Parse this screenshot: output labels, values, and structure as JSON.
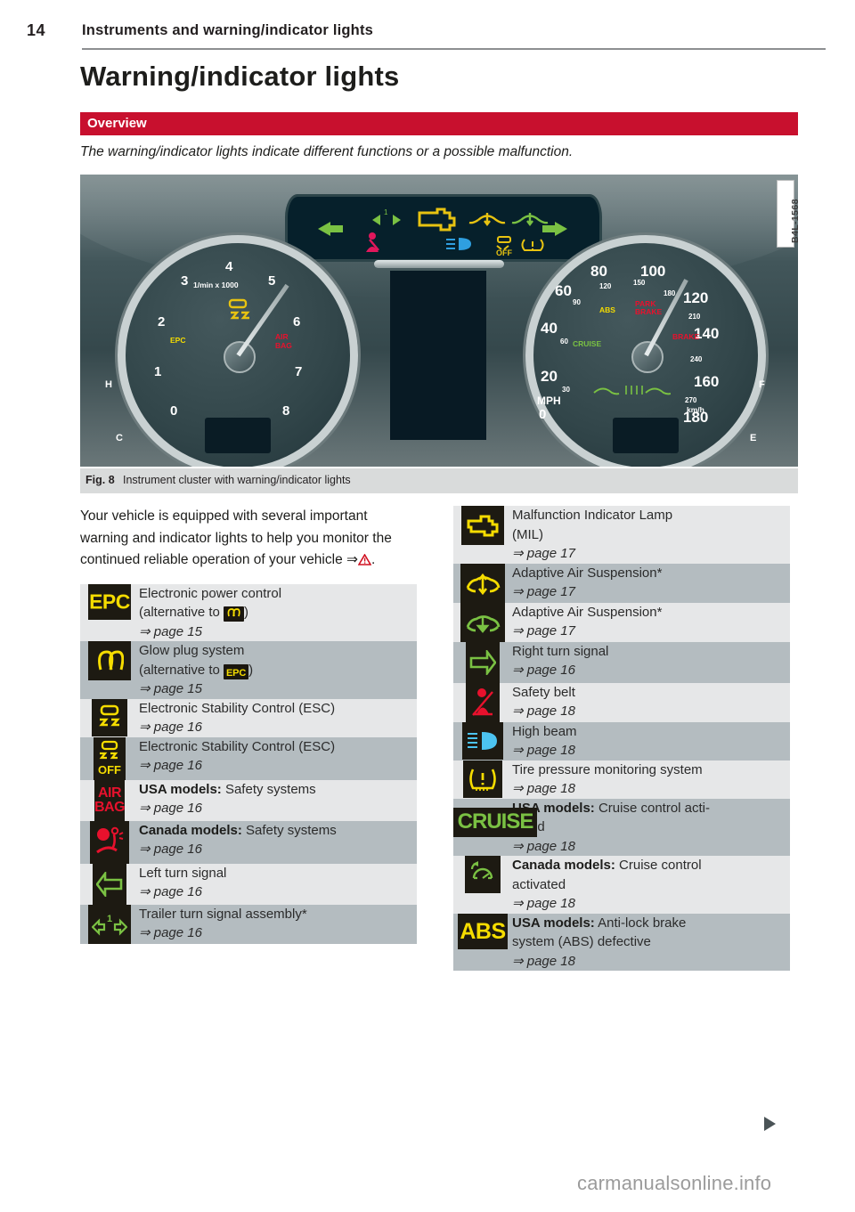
{
  "runhead": {
    "page_number": "14",
    "chapter": "Instruments and warning/indicator lights"
  },
  "heading": "Warning/indicator lights",
  "section_band": {
    "label": "Overview",
    "color": "#c8102e"
  },
  "intro_italic": "The warning/indicator lights indicate different functions or a possible malfunction.",
  "figure": {
    "id_label": "B4L-1568",
    "caption_label": "Fig. 8",
    "caption_text": "Instrument cluster with warning/indicator lights",
    "cluster": {
      "tach_unit": "1/min x 1000",
      "tach_numbers": [
        "1",
        "2",
        "3",
        "4",
        "5",
        "6",
        "7",
        "8",
        "0"
      ],
      "tach_warnings": [
        "EPC",
        "AIR BAG",
        "ESC"
      ],
      "speedo_mph": [
        "0",
        "20",
        "40",
        "60",
        "80",
        "100",
        "120",
        "140",
        "160",
        "180"
      ],
      "speedo_mph_small": [
        "30",
        "60",
        "90",
        "120",
        "150",
        "180"
      ],
      "speedo_kmh": [
        "210",
        "240",
        "270"
      ],
      "speedo_unit_primary": "MPH",
      "speedo_unit_secondary": "km/h",
      "speedo_warnings": [
        "ABS",
        "PARK BRAKE",
        "BRAKE",
        "CRUISE"
      ],
      "temp_gauge": [
        "C",
        "H"
      ],
      "fuel_gauge": [
        "E",
        "F"
      ],
      "top_strip_icons": [
        "left-turn-arrow-icon",
        "trailer-turn-icon",
        "check-engine-icon",
        "suspension-up-icon",
        "suspension-down-icon",
        "right-turn-arrow-icon",
        "safety-belt-icon",
        "high-beam-icon",
        "esc-off-icon",
        "tire-pressure-icon"
      ]
    }
  },
  "intro_paragraph": {
    "text": "Your vehicle is equipped with several important warning and indicator lights to help you monitor the continued reliable operation of your vehicle ",
    "ref_arrow": "⇒",
    "warning_icon": "warning-triangle-icon",
    "period": "."
  },
  "left_table": {
    "rows": [
      {
        "icon_name": "epc-icon",
        "icon_kind": "text",
        "icon_text": "EPC",
        "icon_color": "#f5dc00",
        "lines": [
          "Electronic power control",
          "(alternative to Ⓐ)"
        ],
        "title": "Electronic power control",
        "sub_prefix": "(alternative to ",
        "sub_badge": "glowplug-icon",
        "sub_suffix": ")",
        "ref": "⇒ page 15"
      },
      {
        "icon_name": "glow-plug-icon",
        "icon_kind": "glow",
        "icon_color": "#f5dc00",
        "title": "Glow plug system",
        "sub_prefix": "(alternative to ",
        "sub_badge": "EPC",
        "sub_suffix": ")",
        "ref": "⇒ page 15"
      },
      {
        "icon_name": "esc-icon",
        "icon_kind": "esc",
        "icon_color": "#f5dc00",
        "title": "Electronic Stability Control (ESC)",
        "ref": "⇒ page 16"
      },
      {
        "icon_name": "esc-off-icon",
        "icon_kind": "esc-off",
        "icon_color": "#f5dc00",
        "title": "Electronic Stability Control (ESC)",
        "ref": "⇒ page 16"
      },
      {
        "icon_name": "airbag-icon",
        "icon_kind": "text2",
        "icon_text": "AIR BAG",
        "icon_color": "#e8112d",
        "bold_lead": "USA models:",
        "title": " Safety systems",
        "ref": "⇒ page 16"
      },
      {
        "icon_name": "seatbelt-airbag-canada-icon",
        "icon_kind": "occupant",
        "icon_color": "#e8112d",
        "bold_lead": "Canada models:",
        "title": " Safety systems",
        "ref": "⇒ page 16"
      },
      {
        "icon_name": "left-turn-signal-icon",
        "icon_kind": "arrow-left",
        "icon_color": "#7ac143",
        "title": "Left turn signal",
        "ref": "⇒ page 16"
      },
      {
        "icon_name": "trailer-turn-signal-icon",
        "icon_kind": "trailer",
        "icon_color": "#7ac143",
        "title": "Trailer turn signal assembly*",
        "ref": "⇒ page 16"
      }
    ]
  },
  "right_table": {
    "rows": [
      {
        "icon_name": "check-engine-mil-icon",
        "icon_kind": "engine",
        "icon_color": "#f5dc00",
        "title": "Malfunction Indicator Lamp",
        "title2": "(MIL)",
        "ref": "⇒ page 17"
      },
      {
        "icon_name": "adaptive-air-suspension-up-icon",
        "icon_kind": "susp-up",
        "icon_color": "#f5dc00",
        "title": "Adaptive Air Suspension*",
        "ref": "⇒ page 17"
      },
      {
        "icon_name": "adaptive-air-suspension-down-icon",
        "icon_kind": "susp-down",
        "icon_color": "#7ac143",
        "title": "Adaptive Air Suspension*",
        "ref": "⇒ page 17"
      },
      {
        "icon_name": "right-turn-signal-icon",
        "icon_kind": "arrow-right",
        "icon_color": "#7ac143",
        "title": "Right turn signal",
        "ref": "⇒ page 16"
      },
      {
        "icon_name": "safety-belt-icon",
        "icon_kind": "belt",
        "icon_color": "#e8112d",
        "title": "Safety belt",
        "ref": "⇒ page 18"
      },
      {
        "icon_name": "high-beam-icon",
        "icon_kind": "highbeam",
        "icon_color": "#4cc3f0",
        "title": "High beam",
        "ref": "⇒ page 18"
      },
      {
        "icon_name": "tire-pressure-icon",
        "icon_kind": "tire",
        "icon_color": "#f5dc00",
        "title": "Tire pressure monitoring system",
        "ref": "⇒ page 18"
      },
      {
        "icon_name": "cruise-icon",
        "icon_kind": "cruise-text",
        "icon_text": "CRUISE",
        "icon_color": "#7ac143",
        "bold_lead": "USA models:",
        "title": " Cruise control acti-",
        "title2": "vated",
        "ref": "⇒ page 18"
      },
      {
        "icon_name": "cruise-gauge-icon",
        "icon_kind": "cruise-gauge",
        "icon_color": "#7ac143",
        "bold_lead": "Canada models:",
        "title": " Cruise control",
        "title2": "activated",
        "ref": "⇒ page 18"
      },
      {
        "icon_name": "abs-icon",
        "icon_kind": "text",
        "icon_text": "ABS",
        "icon_color": "#f5dc00",
        "bold_lead": "USA models:",
        "title": " Anti-lock brake",
        "title2": "system (ABS) defective",
        "ref": "⇒ page 18"
      }
    ]
  },
  "continuation_marker": "continue-triangle-icon",
  "watermark": "carmanualsonline.info"
}
